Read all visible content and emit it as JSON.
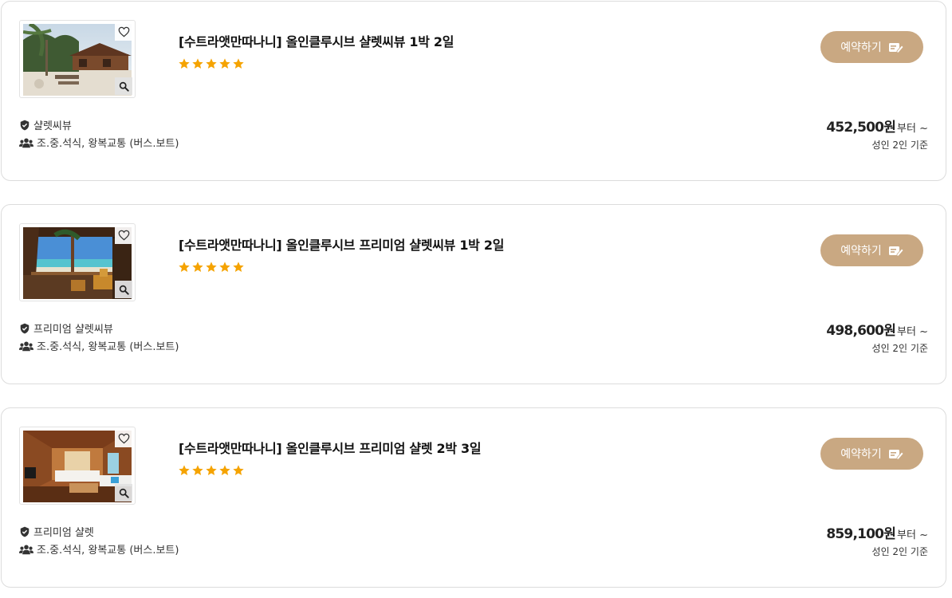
{
  "colors": {
    "accent": "#c9a882",
    "star": "#f5a300",
    "border": "#dcdcdc"
  },
  "products": [
    {
      "title": "[수트라앳만따나니] 올인클루시브 샬렛씨뷰 1박 2일",
      "rating": 5,
      "image": "beach-chalet-photo",
      "book_label": "예약하기",
      "room_type": "샬렛씨뷰",
      "inclusions": "조.중.석식, 왕복교통 (버스.보트)",
      "price": "452,500원",
      "price_suffix": "부터 ~",
      "price_basis": "성인 2인 기준"
    },
    {
      "title": "[수트라앳만따나니] 올인클루시브 프리미엄 샬렛씨뷰 1박 2일",
      "rating": 5,
      "image": "veranda-seaview-photo",
      "book_label": "예약하기",
      "room_type": "프리미엄 샬렛씨뷰",
      "inclusions": "조.중.석식, 왕복교통 (버스.보트)",
      "price": "498,600원",
      "price_suffix": "부터 ~",
      "price_basis": "성인 2인 기준"
    },
    {
      "title": "[수트라앳만따나니] 올인클루시브 프리미엄 샬렛 2박 3일",
      "rating": 5,
      "image": "wooden-bedroom-photo",
      "book_label": "예약하기",
      "room_type": "프리미엄 샬렛",
      "inclusions": "조.중.석식, 왕복교통 (버스.보트)",
      "price": "859,100원",
      "price_suffix": "부터 ~",
      "price_basis": "성인 2인 기준"
    }
  ]
}
